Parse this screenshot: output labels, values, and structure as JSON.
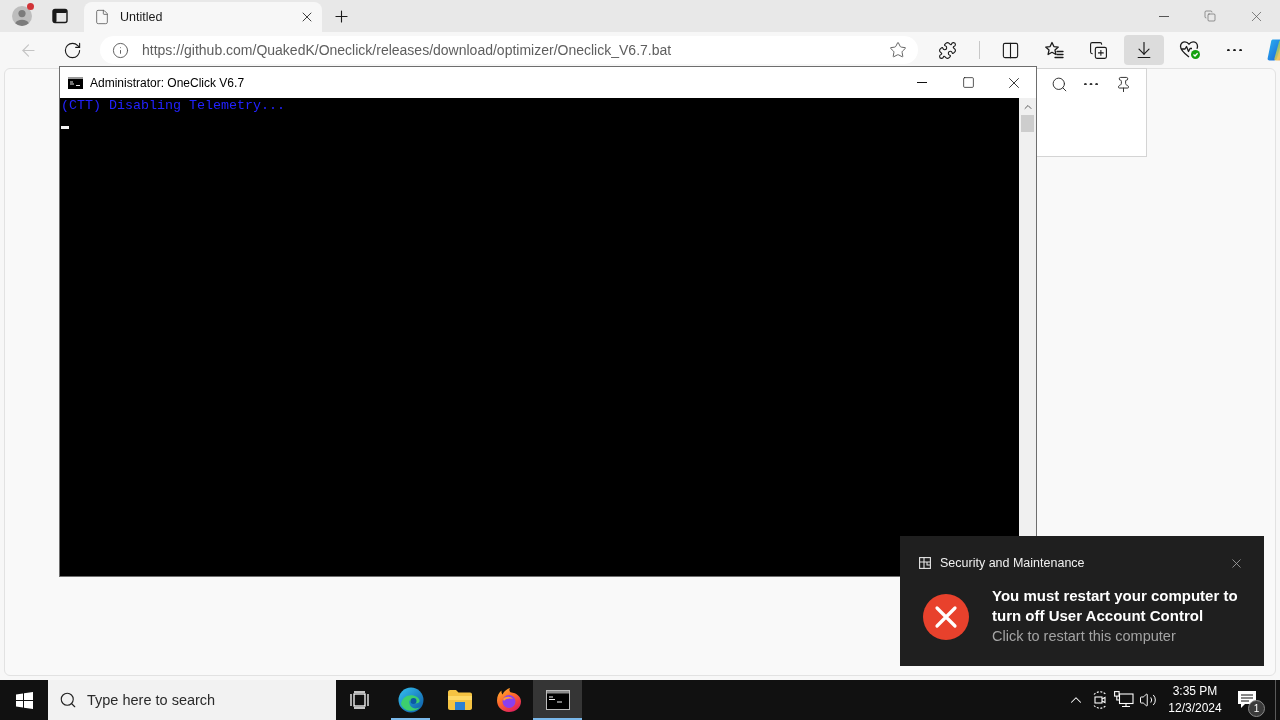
{
  "browser": {
    "tabs": [
      {
        "title": "Untitled",
        "selected": true
      }
    ],
    "nav_buttons": [
      {
        "kind": "back",
        "disabled": true
      },
      {
        "kind": "refresh",
        "disabled": false
      }
    ],
    "address_bar": {
      "url": "https://github.com/QuakedK/Oneclick/releases/download/optimizer/Oneclick_V6.7.bat"
    },
    "toolbar_buttons": [
      {
        "kind": "extensions",
        "selected": false
      },
      {
        "kind": "split_screen",
        "selected": false
      },
      {
        "kind": "favorites",
        "selected": false
      },
      {
        "kind": "collections",
        "selected": false
      },
      {
        "kind": "downloads",
        "selected": true
      },
      {
        "kind": "essentials",
        "selected": false
      },
      {
        "kind": "more",
        "selected": false
      },
      {
        "kind": "assistant",
        "selected": false
      }
    ]
  },
  "console_window": {
    "title": "Administrator: OneClick V6.7",
    "lines": [
      "(CTT) Disabling Telemetry..."
    ],
    "cursor": true
  },
  "notification": {
    "app": "Security and Maintenance",
    "kind": "error",
    "title": "You must restart your computer to turn off User Account Control",
    "body": "Click to restart this computer"
  },
  "taskbar": {
    "search": {
      "placeholder": "Type here to search"
    },
    "apps": [
      {
        "kind": "edge",
        "running": true,
        "selected": false
      },
      {
        "kind": "explorer",
        "running": false,
        "selected": false
      },
      {
        "kind": "firefox",
        "running": false,
        "selected": false
      },
      {
        "kind": "terminal",
        "running": true,
        "selected": true
      }
    ],
    "clock": {
      "time": "3:35 PM",
      "date": "12/3/2024"
    },
    "notification_count": "1"
  }
}
